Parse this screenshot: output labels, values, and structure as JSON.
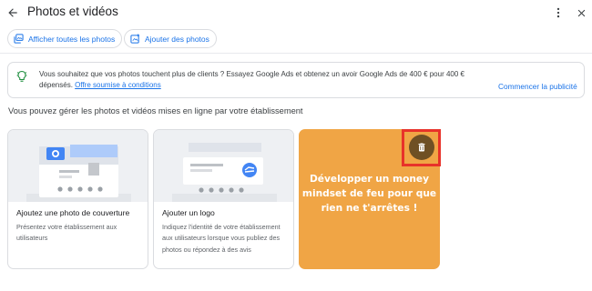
{
  "header": {
    "title": "Photos et vidéos",
    "back_icon": "arrow-back-icon",
    "more_icon": "more-vert-icon",
    "close_icon": "close-icon"
  },
  "toolbar": {
    "view_all_label": "Afficher toutes les photos",
    "add_label": "Ajouter des photos"
  },
  "ad_banner": {
    "text": "Vous souhaitez que vos photos touchent plus de clients ? Essayez Google Ads et obtenez un avoir Google Ads de 400 € pour 400 € dépensés.",
    "link": "Offre soumise à conditions",
    "cta": "Commencer la publicité"
  },
  "section": {
    "title": "Vous pouvez gérer les photos et vidéos mises en ligne par votre établissement"
  },
  "cards": [
    {
      "title": "Ajoutez une photo de couverture",
      "description": "Présentez votre établissement aux utilisateurs"
    },
    {
      "title": "Ajouter un logo",
      "description": "Indiquez l'identité de votre établissement aux utilisateurs lorsque vous publiez des photos ou répondez à des avis"
    }
  ],
  "promo_card": {
    "text": "Développer un money mindset de feu pour que rien ne t'arrêtes !",
    "delete_icon": "trash-icon"
  },
  "colors": {
    "accent": "#1a73e8",
    "promo_bg": "#f0a545",
    "highlight": "#e8322a",
    "delete_bg": "#6f5024"
  }
}
